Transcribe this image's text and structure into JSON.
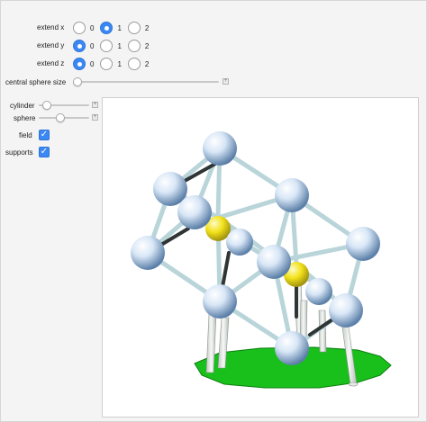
{
  "controls": {
    "extend_x": {
      "label": "extend x",
      "options": [
        "0",
        "1",
        "2"
      ],
      "selected": "1"
    },
    "extend_y": {
      "label": "extend y",
      "options": [
        "0",
        "1",
        "2"
      ],
      "selected": "0"
    },
    "extend_z": {
      "label": "extend z",
      "options": [
        "0",
        "1",
        "2"
      ],
      "selected": "0"
    },
    "central_sphere_size": {
      "label": "central sphere size",
      "value_fraction": 0.0
    },
    "cylinder": {
      "label": "cylinder",
      "value_fraction": 0.12
    },
    "sphere": {
      "label": "sphere",
      "value_fraction": 0.4
    },
    "field": {
      "label": "field",
      "checked": true
    },
    "supports": {
      "label": "supports",
      "checked": true
    }
  },
  "graphic": {
    "description_icon": "atomium-3d-model",
    "colors": {
      "ground": "#19c01b",
      "central_sphere": "#f2e21a",
      "sphere": "#c8dcf2",
      "rod": "#b9d5da",
      "support": "#e9ece8"
    }
  }
}
